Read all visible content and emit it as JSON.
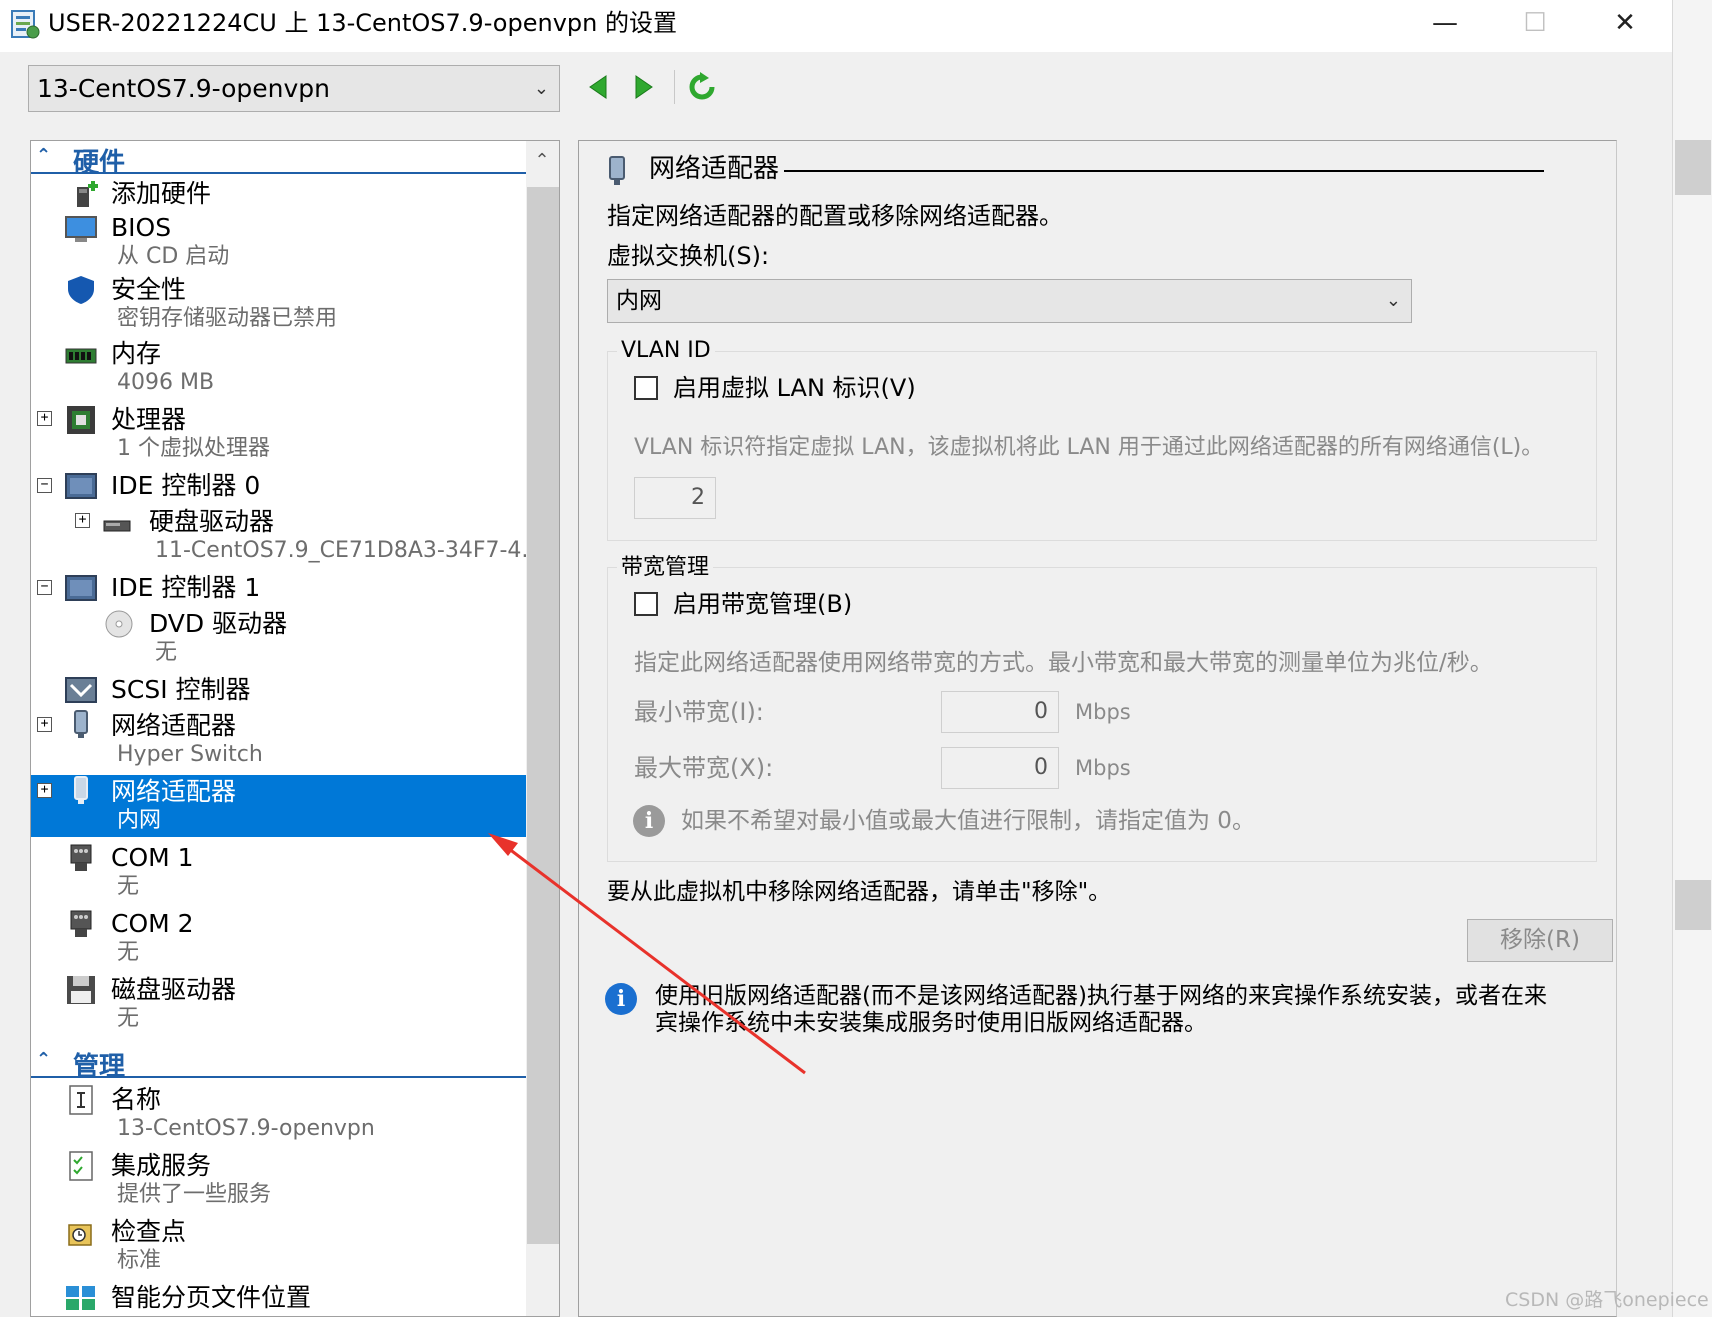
{
  "window": {
    "title": "USER-20221224CU 上 13-CentOS7.9-openvpn 的设置",
    "minimize": "—",
    "maximize": "☐",
    "close": "✕"
  },
  "toolbar": {
    "vm_name": "13-CentOS7.9-openvpn"
  },
  "tree": {
    "hardware_header": "硬件",
    "management_header": "管理",
    "hardware": [
      {
        "label": "添加硬件",
        "sub": "",
        "icon": "add-hardware-icon"
      },
      {
        "label": "BIOS",
        "sub": "从 CD 启动",
        "icon": "bios-monitor-icon"
      },
      {
        "label": "安全性",
        "sub": "密钥存储驱动器已禁用",
        "icon": "shield-icon"
      },
      {
        "label": "内存",
        "sub": "4096 MB",
        "icon": "memory-icon"
      },
      {
        "label": "处理器",
        "sub": "1 个虚拟处理器",
        "icon": "cpu-icon"
      },
      {
        "label": "IDE 控制器 0",
        "sub": "",
        "icon": "ide-controller-icon"
      },
      {
        "label": "硬盘驱动器",
        "sub": "11-CentOS7.9_CE71D8A3-34F7-4...",
        "icon": "hard-drive-icon"
      },
      {
        "label": "IDE 控制器 1",
        "sub": "",
        "icon": "ide-controller-icon"
      },
      {
        "label": "DVD 驱动器",
        "sub": "无",
        "icon": "dvd-icon"
      },
      {
        "label": "SCSI 控制器",
        "sub": "",
        "icon": "scsi-controller-icon"
      },
      {
        "label": "网络适配器",
        "sub": "Hyper Switch",
        "icon": "network-adapter-icon"
      },
      {
        "label": "网络适配器",
        "sub": "内网",
        "icon": "network-adapter-icon"
      },
      {
        "label": "COM 1",
        "sub": "无",
        "icon": "com-port-icon"
      },
      {
        "label": "COM 2",
        "sub": "无",
        "icon": "com-port-icon"
      },
      {
        "label": "磁盘驱动器",
        "sub": "无",
        "icon": "floppy-icon"
      }
    ],
    "management": [
      {
        "label": "名称",
        "sub": "13-CentOS7.9-openvpn",
        "icon": "name-icon"
      },
      {
        "label": "集成服务",
        "sub": "提供了一些服务",
        "icon": "integration-services-icon"
      },
      {
        "label": "检查点",
        "sub": "标准",
        "icon": "checkpoint-icon"
      },
      {
        "label": "智能分页文件位置",
        "sub": "",
        "icon": "smart-paging-icon"
      }
    ]
  },
  "detail": {
    "heading": "网络适配器",
    "description": "指定网络适配器的配置或移除网络适配器。",
    "switch_label": "虚拟交换机(S):",
    "switch_value": "内网",
    "vlan_group": "VLAN ID",
    "vlan_checkbox": "启用虚拟 LAN 标识(V)",
    "vlan_help": "VLAN 标识符指定虚拟 LAN，该虚拟机将此 LAN 用于通过此网络适配器的所有网络通信(L)。",
    "vlan_value": "2",
    "bw_group": "带宽管理",
    "bw_checkbox": "启用带宽管理(B)",
    "bw_help": "指定此网络适配器使用网络带宽的方式。最小带宽和最大带宽的测量单位为兆位/秒。",
    "min_label": "最小带宽(I):",
    "min_value": "0",
    "max_label": "最大带宽(X):",
    "max_value": "0",
    "unit": "Mbps",
    "bw_note": "如果不希望对最小值或最大值进行限制，请指定值为 0。",
    "remove_text": "要从此虚拟机中移除网络适配器，请单击\"移除\"。",
    "remove_button": "移除(R)",
    "legacy_note_1": "使用旧版网络适配器(而不是该网络适配器)执行基于网络的来宾操作系统安装，或者在来",
    "legacy_note_2": "宾操作系统中未安装集成服务时使用旧版网络适配器。"
  },
  "watermark": "CSDN @路飞onepiece",
  "colors": {
    "selection": "#0078d7",
    "section_header": "#1f5fa8",
    "info_blue": "#1a6fd0",
    "annotation_arrow": "#e8322b"
  }
}
